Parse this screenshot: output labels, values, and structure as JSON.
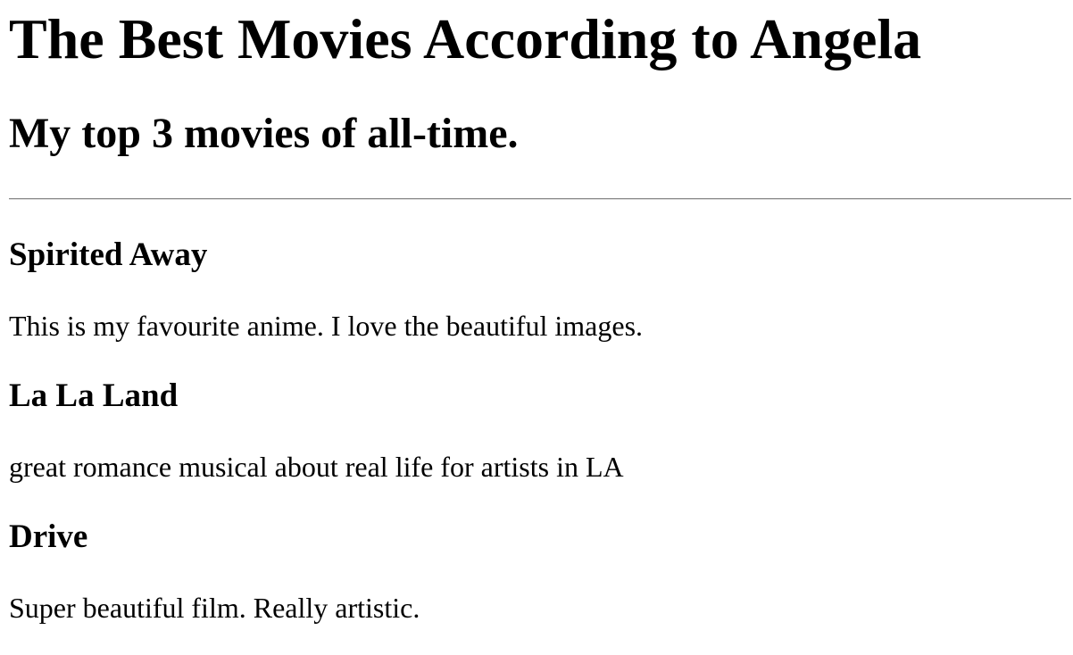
{
  "page": {
    "title": "The Best Movies According to Angela",
    "subtitle": "My top 3 movies of all-time."
  },
  "movies": [
    {
      "title": "Spirited Away",
      "description": "This is my favourite anime. I love the beautiful images."
    },
    {
      "title": "La La Land",
      "description": "great romance musical about real life for artists in LA"
    },
    {
      "title": "Drive",
      "description": "Super beautiful film. Really artistic."
    }
  ]
}
